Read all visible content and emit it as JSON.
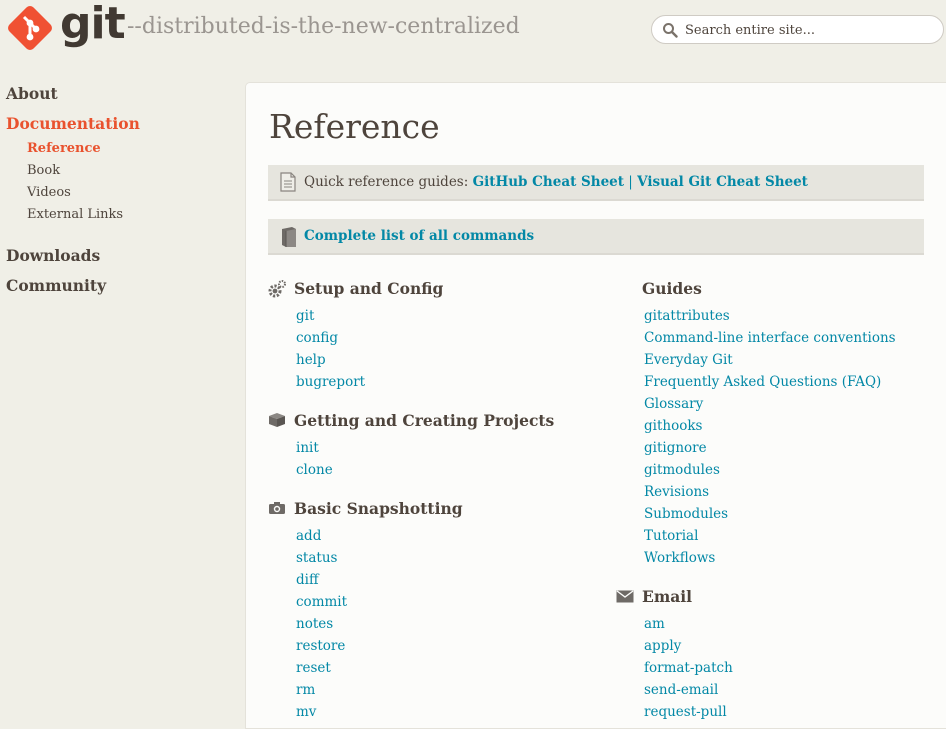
{
  "brand": {
    "wordmark": "git",
    "tagline": "--distributed-is-the-new-centralized",
    "logo_color": "#f05133",
    "logo_icon": "git-logo-icon"
  },
  "search": {
    "placeholder": "Search entire site...",
    "value": "",
    "icon": "search-icon"
  },
  "sidebar": {
    "items": [
      {
        "label": "About"
      },
      {
        "label": "Documentation",
        "active": true,
        "children": [
          {
            "label": "Reference",
            "active": true
          },
          {
            "label": "Book"
          },
          {
            "label": "Videos"
          },
          {
            "label": "External Links"
          }
        ]
      },
      {
        "label": "Downloads"
      },
      {
        "label": "Community"
      }
    ]
  },
  "main": {
    "title": "Reference",
    "quick_ref": {
      "prefix": "Quick reference guides:",
      "links": [
        "GitHub Cheat Sheet",
        "Visual Git Cheat Sheet"
      ],
      "separator": "|",
      "icon": "document-icon"
    },
    "all_commands": {
      "label": "Complete list of all commands",
      "icon": "book-icon"
    },
    "sections_left": [
      {
        "title": "Setup and Config",
        "icon": "gears-icon",
        "items": [
          "git",
          "config",
          "help",
          "bugreport"
        ]
      },
      {
        "title": "Getting and Creating Projects",
        "icon": "box-icon",
        "items": [
          "init",
          "clone"
        ]
      },
      {
        "title": "Basic Snapshotting",
        "icon": "camera-icon",
        "items": [
          "add",
          "status",
          "diff",
          "commit",
          "notes",
          "restore",
          "reset",
          "rm",
          "mv"
        ]
      }
    ],
    "sections_right": [
      {
        "title": "Guides",
        "items": [
          "gitattributes",
          "Command-line interface conventions",
          "Everyday Git",
          "Frequently Asked Questions (FAQ)",
          "Glossary",
          "githooks",
          "gitignore",
          "gitmodules",
          "Revisions",
          "Submodules",
          "Tutorial",
          "Workflows"
        ]
      },
      {
        "title": "Email",
        "icon": "envelope-icon",
        "items": [
          "am",
          "apply",
          "format-patch",
          "send-email",
          "request-pull"
        ]
      }
    ]
  },
  "colors": {
    "accent": "#e9522e",
    "link": "#0388a6",
    "text": "#4e443c",
    "page_bg": "#f0efe7",
    "content_bg": "#fcfcfa"
  }
}
